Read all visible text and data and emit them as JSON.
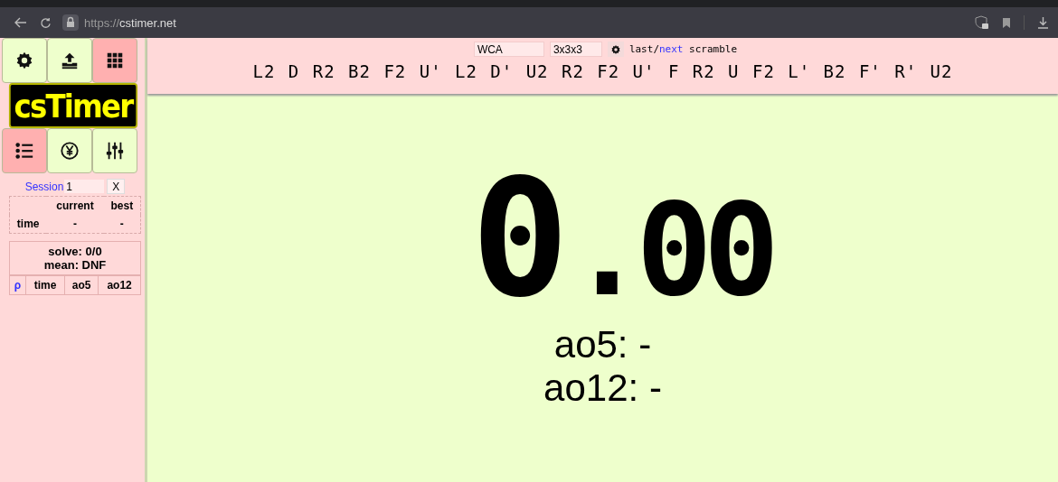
{
  "browser": {
    "url_scheme": "https://",
    "url_host": "cstimer.net"
  },
  "tool_buttons": [
    {
      "selected": false
    },
    {
      "selected": false
    },
    {
      "selected": true
    }
  ],
  "logo": "csTimer",
  "panel_buttons": [
    {
      "selected": true
    },
    {
      "selected": false
    },
    {
      "selected": false
    }
  ],
  "session": {
    "label": "Session",
    "value": "1",
    "close": "X"
  },
  "stats": {
    "columns": [
      "current",
      "best"
    ],
    "rows": [
      {
        "label": "time",
        "current": "-",
        "best": "-"
      }
    ]
  },
  "summary": {
    "solve": "solve: 0/0",
    "mean": "mean: DNF"
  },
  "times_table": {
    "search": "ρ",
    "columns": [
      "time",
      "ao5",
      "ao12"
    ]
  },
  "scramble_bar": {
    "type": "WCA",
    "puzzle": "3x3x3",
    "last": "last",
    "sep": "/",
    "next": "next",
    "word": "scramble",
    "scramble": "L2 D R2 B2 F2 U' L2 D' U2 R2 F2 U' F R2 U F2 L' B2 F' R' U2"
  },
  "timer": {
    "whole": "0",
    "fraction": ".00"
  },
  "averages": [
    "ao5: -",
    "ao12: -"
  ]
}
